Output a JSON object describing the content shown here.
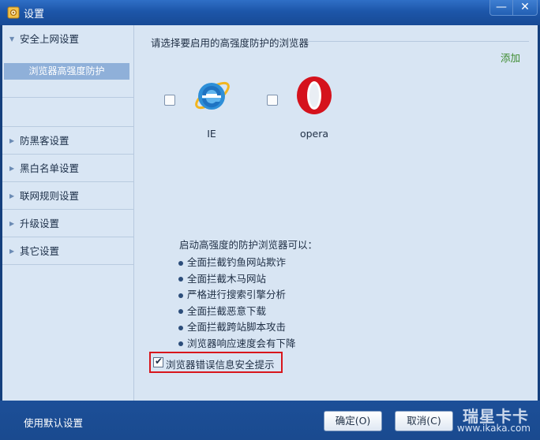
{
  "window": {
    "title": "设置",
    "minimize_glyph": "—",
    "close_glyph": "✕"
  },
  "sidebar": {
    "items": [
      {
        "label": "安全上网设置",
        "expanded": true,
        "sub_items": [
          {
            "label": "浏览器高强度防护",
            "selected": true
          }
        ]
      },
      {
        "label": "防黑客设置"
      },
      {
        "label": "黑白名单设置"
      },
      {
        "label": "联网规则设置"
      },
      {
        "label": "升级设置"
      },
      {
        "label": "其它设置"
      }
    ]
  },
  "main": {
    "group_title": "请选择要启用的高强度防护的浏览器",
    "add_label": "添加",
    "browsers": [
      {
        "name": "IE",
        "icon": "ie-icon",
        "checked": false
      },
      {
        "name": "opera",
        "icon": "opera-icon",
        "checked": false
      }
    ],
    "info_heading": "启动高强度的防护浏览器可以：",
    "info_items": [
      "全面拦截钓鱼网站欺诈",
      "全面拦截木马网站",
      "严格进行搜索引擎分析",
      "全面拦截恶意下载",
      "全面拦截跨站脚本攻击",
      "浏览器响应速度会有下降"
    ],
    "error_tip": {
      "label": "浏览器错误信息安全提示",
      "checked": true
    }
  },
  "footer": {
    "default_label": "使用默认设置",
    "ok_label": "确定(O)",
    "cancel_label": "取消(C)"
  },
  "watermark": {
    "title": "瑞星卡卡",
    "url": "www.ikaka.com"
  },
  "colors": {
    "title_bar": "#1d56a9",
    "client_bg": "#d8e5f3",
    "selected_item": "#8fb0d9",
    "add_link": "#3d8b2f",
    "highlight_border": "#d8161c"
  }
}
